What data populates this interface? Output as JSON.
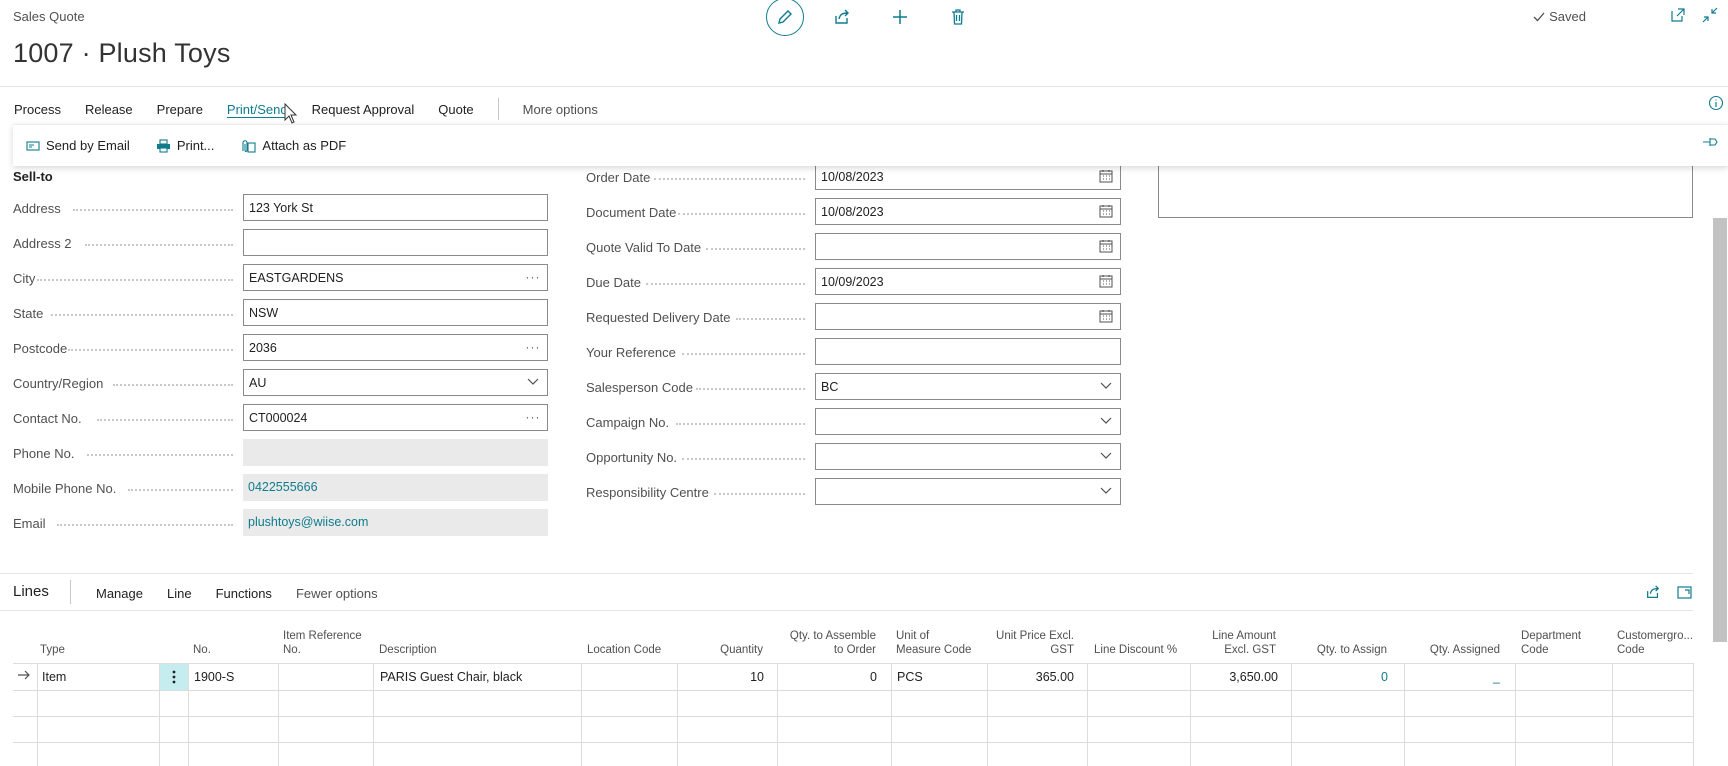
{
  "header": {
    "doc_kind": "Sales Quote",
    "title": "1007 · Plush Toys",
    "saved": "Saved",
    "toolbar_icons": [
      "edit-icon",
      "share-icon",
      "add-icon",
      "delete-icon"
    ]
  },
  "actions": {
    "items": [
      "Process",
      "Release",
      "Prepare",
      "Print/Send",
      "Request Approval",
      "Quote"
    ],
    "active": "Print/Send",
    "more": "More options"
  },
  "print_send": {
    "items": [
      {
        "label": "Send by Email",
        "icon": "email-icon"
      },
      {
        "label": "Print...",
        "icon": "printer-icon"
      },
      {
        "label": "Attach as PDF",
        "icon": "attach-icon"
      }
    ]
  },
  "sell_to": {
    "title": "Sell-to",
    "fields": [
      {
        "label": "Address",
        "value": "123 York St",
        "kind": "text"
      },
      {
        "label": "Address 2",
        "value": "",
        "kind": "text"
      },
      {
        "label": "City",
        "value": "EASTGARDENS",
        "kind": "lookup"
      },
      {
        "label": "State",
        "value": "NSW",
        "kind": "text"
      },
      {
        "label": "Postcode",
        "value": "2036",
        "kind": "lookup"
      },
      {
        "label": "Country/Region",
        "value": "AU",
        "kind": "dropdown"
      },
      {
        "label": "Contact No.",
        "value": "CT000024",
        "kind": "lookup"
      },
      {
        "label": "Phone No.",
        "value": "",
        "kind": "readonly"
      },
      {
        "label": "Mobile Phone No.",
        "value": "0422555666",
        "kind": "readonly-link"
      },
      {
        "label": "Email",
        "value": "plushtoys@wiise.com",
        "kind": "readonly-link"
      }
    ]
  },
  "dates": {
    "fields": [
      {
        "label": "Order Date",
        "value": "10/08/2023",
        "kind": "date"
      },
      {
        "label": "Document Date",
        "value": "10/08/2023",
        "kind": "date"
      },
      {
        "label": "Quote Valid To Date",
        "value": "",
        "kind": "date"
      },
      {
        "label": "Due Date",
        "value": "10/09/2023",
        "kind": "date"
      },
      {
        "label": "Requested Delivery Date",
        "value": "",
        "kind": "date"
      },
      {
        "label": "Your Reference",
        "value": "",
        "kind": "text"
      },
      {
        "label": "Salesperson Code",
        "value": "BC",
        "kind": "dropdown"
      },
      {
        "label": "Campaign No.",
        "value": "",
        "kind": "dropdown"
      },
      {
        "label": "Opportunity No.",
        "value": "",
        "kind": "dropdown"
      },
      {
        "label": "Responsibility Centre",
        "value": "",
        "kind": "dropdown"
      }
    ]
  },
  "lines": {
    "title": "Lines",
    "actions": [
      "Manage",
      "Line",
      "Functions"
    ],
    "fewer": "Fewer options",
    "columns": [
      [
        "",
        "Type"
      ],
      [
        "",
        "No."
      ],
      [
        "Item Reference",
        "No."
      ],
      [
        "",
        "Description"
      ],
      [
        "",
        "Location Code"
      ],
      [
        "",
        "Quantity"
      ],
      [
        "Qty. to Assemble",
        "to Order"
      ],
      [
        "Unit of",
        "Measure Code"
      ],
      [
        "Unit Price Excl.",
        "GST"
      ],
      [
        "",
        "Line Discount %"
      ],
      [
        "Line Amount",
        "Excl. GST"
      ],
      [
        "",
        "Qty. to Assign"
      ],
      [
        "",
        "Qty. Assigned"
      ],
      [
        "Department",
        "Code"
      ],
      [
        "Customergro...",
        "Code"
      ]
    ],
    "rows": [
      {
        "type": "Item",
        "no": "1900-S",
        "item_ref": "",
        "description": "PARIS Guest Chair, black",
        "location": "",
        "quantity": "10",
        "qty_assemble": "0",
        "uom": "PCS",
        "unit_price": "365.00",
        "line_discount": "",
        "line_amount": "3,650.00",
        "qty_to_assign": "0",
        "qty_assigned": "_",
        "department": "",
        "customergroup": ""
      }
    ]
  }
}
